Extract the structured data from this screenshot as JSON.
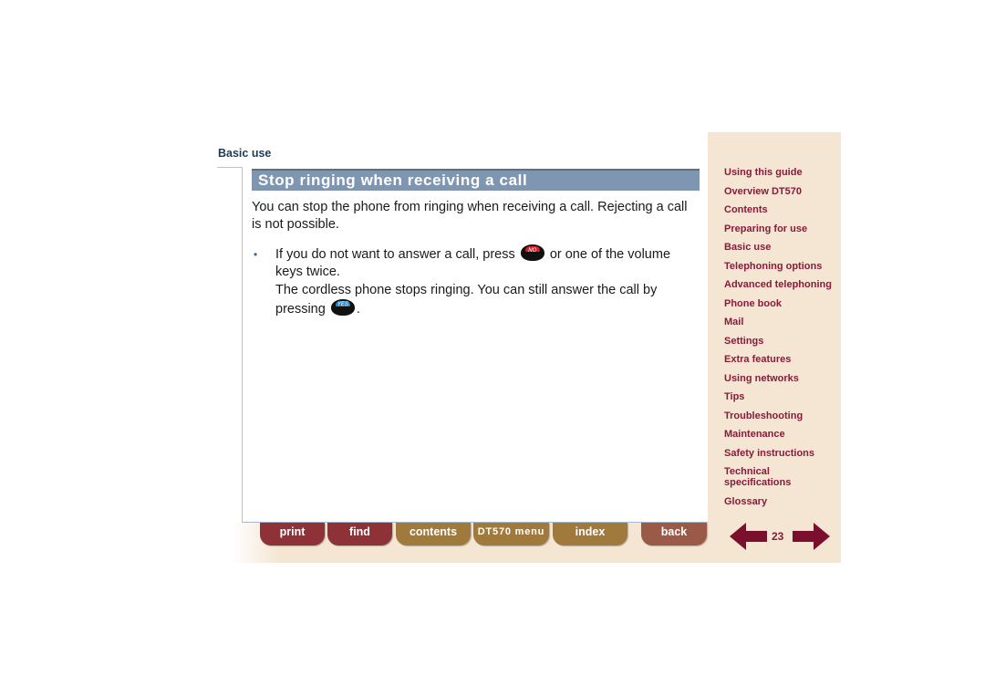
{
  "header": {
    "section_label": "Basic use"
  },
  "main": {
    "title": "Stop ringing when receiving a call",
    "intro": "You can stop the phone from ringing when receiving a call. Rejecting a call is not possible.",
    "bullet_marker": "•",
    "bullet_text_before": "If you do not want to answer a call, press",
    "bullet_text_after": "or one of the volume keys twice.",
    "followup_before": "The cordless phone stops ringing. You can still answer the call by pressing",
    "followup_after": ".",
    "keys": {
      "no_key": {
        "icon": "no-key-icon",
        "label": "NO",
        "color": "#d8202a"
      },
      "yes_key": {
        "icon": "yes-key-icon",
        "label": "YES",
        "color": "#2a8acc"
      }
    }
  },
  "sidebar": {
    "items": [
      {
        "label": "Using this guide"
      },
      {
        "label": "Overview DT570"
      },
      {
        "label": "Contents"
      },
      {
        "label": "Preparing for use"
      },
      {
        "label": "Basic use"
      },
      {
        "label": "Telephoning options"
      },
      {
        "label": "Advanced telephoning"
      },
      {
        "label": "Phone book"
      },
      {
        "label": "Mail"
      },
      {
        "label": "Settings"
      },
      {
        "label": "Extra features"
      },
      {
        "label": "Using networks"
      },
      {
        "label": "Tips"
      },
      {
        "label": "Troubleshooting"
      },
      {
        "label": "Maintenance"
      },
      {
        "label": "Safety instructions"
      },
      {
        "label": "Technical specifications"
      },
      {
        "label": "Glossary"
      }
    ]
  },
  "toolbar": {
    "print": "print",
    "find": "find",
    "contents": "contents",
    "menu": "DT570 menu",
    "index": "index",
    "back": "back"
  },
  "pagination": {
    "page": "23",
    "prev_icon": "arrow-left-icon",
    "next_icon": "arrow-right-icon"
  },
  "colors": {
    "title_bar": "#7f96b2",
    "nav_text": "#8a1a3a",
    "sidebar_bg": "#f5e6d4",
    "btn_red": "#8f3238",
    "btn_gold": "#a07a3c",
    "btn_brown": "#9b5a48"
  }
}
